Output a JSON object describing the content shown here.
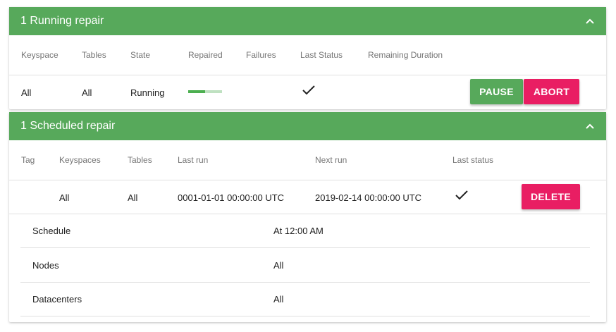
{
  "running": {
    "title": "1 Running repair",
    "headers": {
      "keyspace": "Keyspace",
      "tables": "Tables",
      "state": "State",
      "repaired": "Repaired",
      "failures": "Failures",
      "last_status": "Last Status",
      "remaining": "Remaining Duration"
    },
    "row": {
      "keyspace": "All",
      "tables": "All",
      "state": "Running",
      "repaired_fraction": 0.5,
      "failures": "",
      "last_status_icon": "check-icon",
      "remaining": ""
    },
    "pause_label": "PAUSE",
    "abort_label": "ABORT"
  },
  "scheduled": {
    "title": "1 Scheduled repair",
    "headers": {
      "tag": "Tag",
      "keyspaces": "Keyspaces",
      "tables": "Tables",
      "last_run": "Last run",
      "next_run": "Next run",
      "last_status": "Last status"
    },
    "row": {
      "tag": "",
      "keyspaces": "All",
      "tables": "All",
      "last_run": "0001-01-01 00:00:00 UTC",
      "next_run": "2019-02-14 00:00:00 UTC",
      "last_status_icon": "check-icon"
    },
    "delete_label": "DELETE",
    "details": [
      {
        "label": "Schedule",
        "value": "At 12:00 AM"
      },
      {
        "label": "Nodes",
        "value": "All"
      },
      {
        "label": "Datacenters",
        "value": "All"
      }
    ]
  },
  "colors": {
    "header_green": "#57a95b",
    "button_green": "#57a95b",
    "button_pink": "#e91e63",
    "progress_fill": "#4caf50",
    "progress_track": "#bfe1c1"
  }
}
